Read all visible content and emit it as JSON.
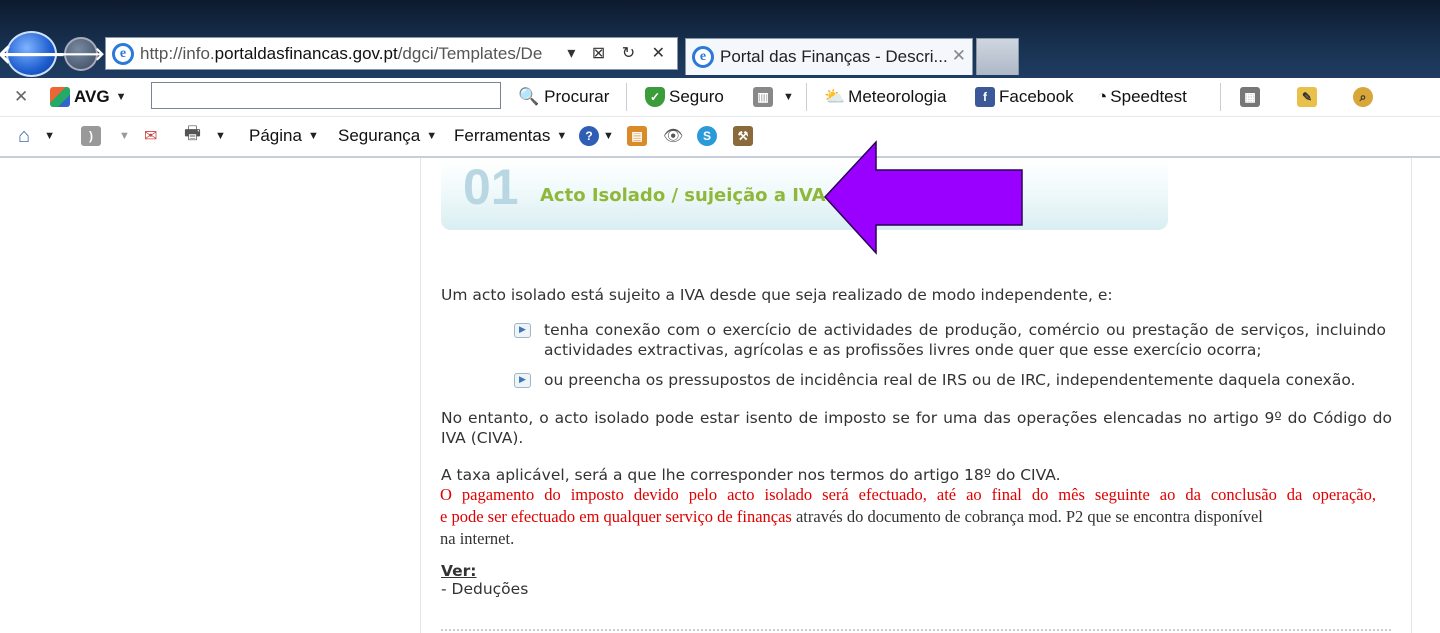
{
  "browser": {
    "address": {
      "prefix": "http://info.",
      "domain": "portaldasfinancas.gov.pt",
      "suffix": "/dgci/Templates/De"
    },
    "tab_title": "Portal das Finanças - Descri...",
    "tab_close": "✕",
    "address_controls": "▾ ⊠ ↻ ✕"
  },
  "toolbar1": {
    "close": "✕",
    "avg_label": "AVG",
    "search_placeholder": "",
    "procurar": "Procurar",
    "seguro": "Seguro",
    "meteorologia": "Meteorologia",
    "facebook": "Facebook",
    "speedtest": "Speedtest"
  },
  "toolbar2": {
    "pagina": "Página",
    "seguranca": "Segurança",
    "ferramentas": "Ferramentas"
  },
  "content": {
    "number": "01",
    "heading": "Acto Isolado / sujeição a IVA",
    "intro": "Um acto isolado está sujeito a IVA desde que seja realizado de modo independente, e:",
    "bullet1_line1": "tenha conexão com o exercício de actividades de produção, comércio ou prestação de serviços, incluindo",
    "bullet1_line2": "actividades extractivas, agrícolas e as profissões livres onde quer que esse exercício ocorra;",
    "bullet2": "ou preencha os pressupostos de incidência real de IRS ou de IRC, independentemente daquela conexão.",
    "para2_line1": "No entanto, o acto isolado pode estar isento de imposto se for uma das operações elencadas no artigo 9º do Código do",
    "para2_line2": "IVA (CIVA).",
    "para3": "A taxa aplicável, será a que lhe corresponder nos termos do artigo 18º do CIVA.",
    "red_line1": "O pagamento do imposto devido pelo acto isolado será efectuado, até ao final do mês seguinte ao da conclusão da operação,",
    "red_line2": "e pode ser efectuado em qualquer serviço de finanças",
    "black_line2": " através do documento de cobrança mod. P2 que se encontra disponível",
    "black_line3": "na internet.",
    "ver_label": "Ver:",
    "ver_link": "- Deduções"
  },
  "colors": {
    "arrow": "#9900ff",
    "heading": "#8fb83a",
    "number": "#b9d7e2",
    "red_text": "#e00000"
  }
}
